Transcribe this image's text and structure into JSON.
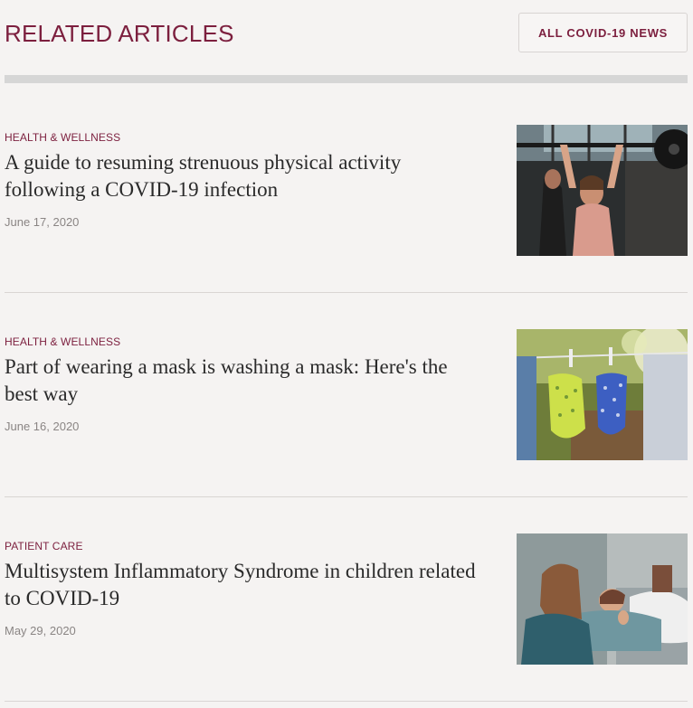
{
  "header": {
    "title": "RELATED ARTICLES",
    "all_news_label": "ALL COVID-19 NEWS"
  },
  "articles": [
    {
      "category": "HEALTH & WELLNESS",
      "headline": "A guide to resuming strenuous physical activity following a COVID-19 infection",
      "date": "June 17, 2020",
      "image": "woman-lifting-barbell-image"
    },
    {
      "category": "HEALTH & WELLNESS",
      "headline": "Part of wearing a mask is washing a mask: Here's the best way",
      "date": "June 16, 2020",
      "image": "masks-on-clothesline-image"
    },
    {
      "category": "PATIENT CARE",
      "headline": "Multisystem Inflammatory Syndrome in children related to COVID-19",
      "date": "May 29, 2020",
      "image": "mother-and-sick-child-image"
    }
  ],
  "colors": {
    "accent": "#7c1f3e",
    "background": "#f5f3f2",
    "headline": "#2a2a2a",
    "date": "#8a8584"
  }
}
